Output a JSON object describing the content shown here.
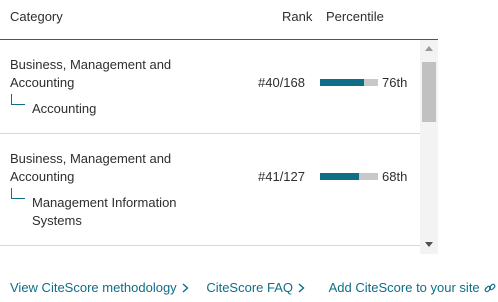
{
  "header": {
    "category_label": "Category",
    "rank_label": "Rank",
    "percentile_label": "Percentile"
  },
  "rows": [
    {
      "category": "Business, Management and Accounting",
      "subcategory": "Accounting",
      "rank": "#40/168",
      "percentile_value": 76,
      "percentile_text": "76th"
    },
    {
      "category": "Business, Management and Accounting",
      "subcategory": "Management Information Systems",
      "rank": "#41/127",
      "percentile_value": 68,
      "percentile_text": "68th"
    }
  ],
  "footer": {
    "methodology_link": "View CiteScore methodology",
    "faq_link": "CiteScore FAQ",
    "add_link": "Add CiteScore to your site",
    "chevron_icon": "chevron-right-icon",
    "link_icon": "external-link-icon"
  },
  "colors": {
    "accent": "#0e6e88",
    "bar_track": "#c8c8c8",
    "text": "#2e2e2e"
  }
}
